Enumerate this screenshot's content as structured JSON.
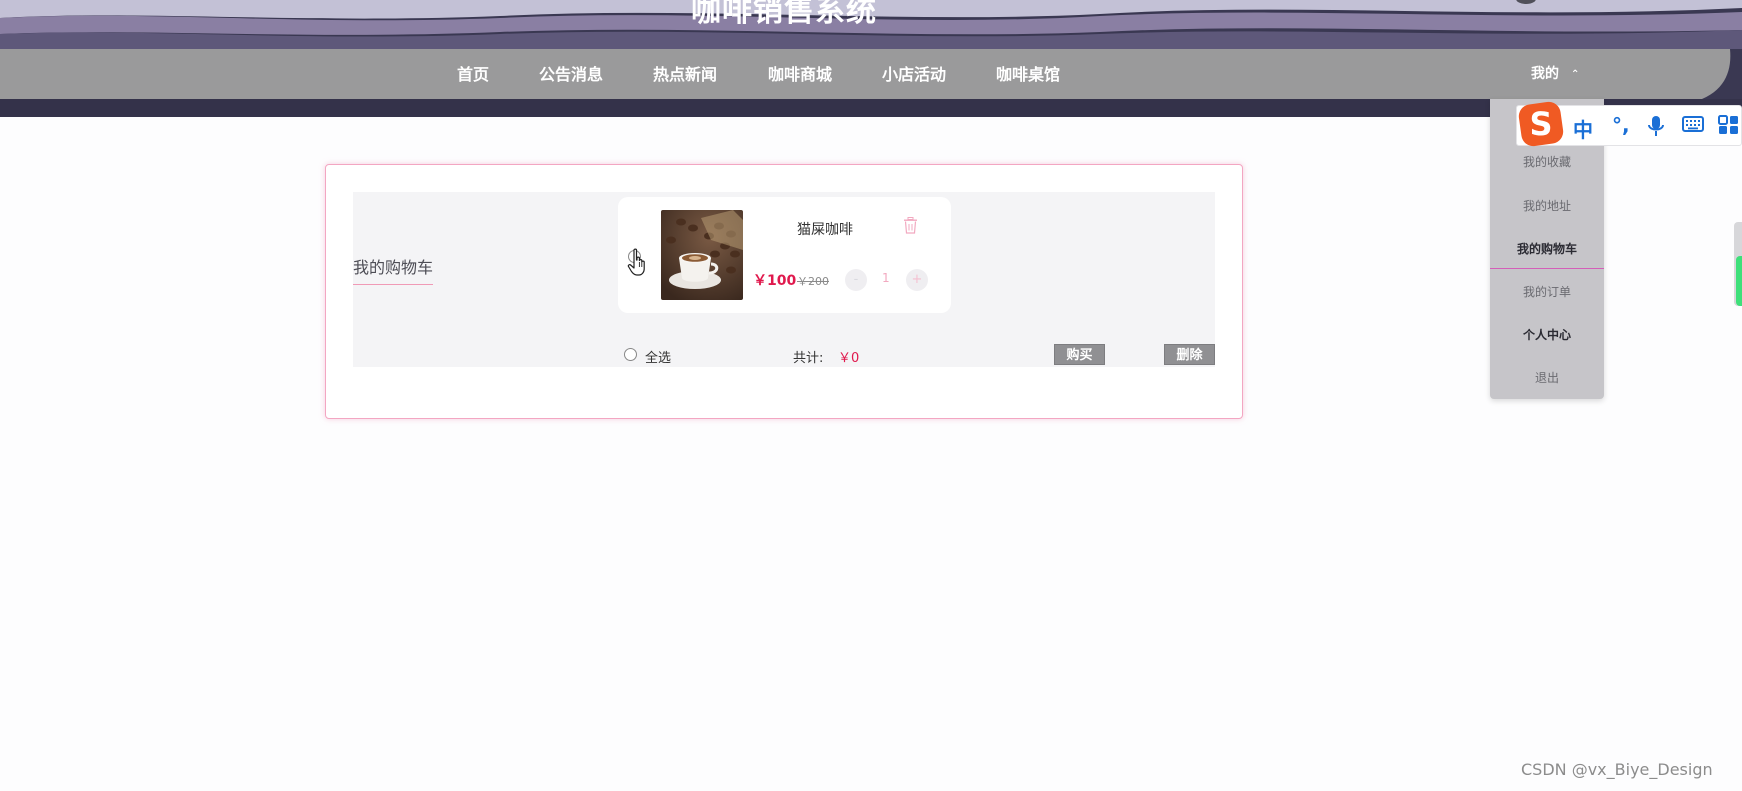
{
  "header": {
    "site_title": "咖啡销售系统"
  },
  "nav": {
    "items": [
      "首页",
      "公告消息",
      "热点新闻",
      "咖啡商城",
      "小店活动",
      "咖啡桌馆"
    ],
    "me_label": "我的",
    "me_caret": "⌃"
  },
  "dropdown": {
    "items": [
      "我的收藏",
      "我的地址",
      "我的购物车",
      "我的订单",
      "个人中心",
      "退出"
    ]
  },
  "cart": {
    "title": "我的购物车",
    "item": {
      "name": "猫屎咖啡",
      "price": "￥100",
      "original_price": "￥200",
      "quantity": "1",
      "minus": "-",
      "plus": "+"
    },
    "select_all": "全选",
    "total_label": "共计:",
    "total_value": "￥0",
    "buy_button": "购买",
    "delete_button": "删除"
  },
  "ime": {
    "mode": "中",
    "punct": "°,"
  },
  "watermark": "CSDN @vx_Biye_Design",
  "colors": {
    "accent_pink": "#f3a6c2",
    "price_red": "#e0194d",
    "nav_gray": "#9a9a9b",
    "ime_blue": "#1a6fd6"
  }
}
